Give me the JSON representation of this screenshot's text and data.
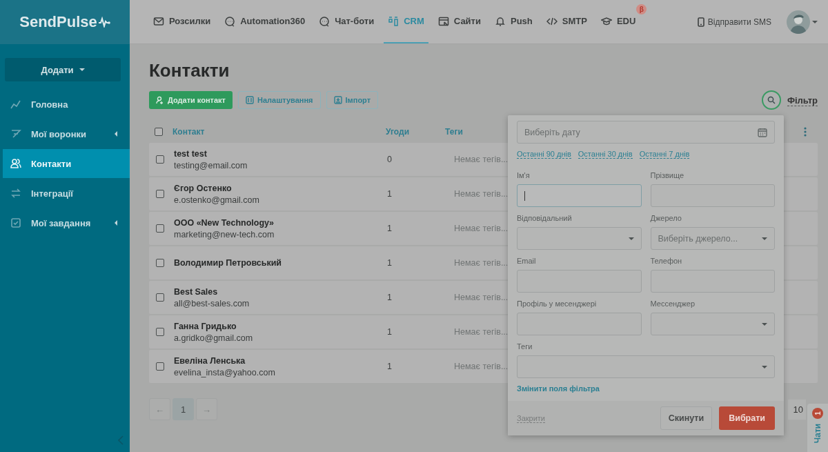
{
  "logo": "SendPulse",
  "nav": [
    {
      "label": "Розсилки",
      "selected": false
    },
    {
      "label": "Automation360",
      "selected": false
    },
    {
      "label": "Чат-боти",
      "selected": false
    },
    {
      "label": "CRM",
      "selected": true
    },
    {
      "label": "Сайти",
      "selected": false
    },
    {
      "label": "Push",
      "selected": false
    },
    {
      "label": "SMTP",
      "selected": false
    },
    {
      "label": "EDU",
      "selected": false,
      "badge": "β"
    }
  ],
  "sms_link": "Відправити SMS",
  "sidebar": {
    "add_button": "Додати",
    "items": [
      {
        "label": "Головна",
        "selected": false,
        "expandable": false
      },
      {
        "label": "Мої воронки",
        "selected": false,
        "expandable": true
      },
      {
        "label": "Контакти",
        "selected": true,
        "expandable": false
      },
      {
        "label": "Інтеграції",
        "selected": false,
        "expandable": false
      },
      {
        "label": "Мої завдання",
        "selected": false,
        "expandable": true
      }
    ]
  },
  "page_title": "Контакти",
  "toolbar": [
    {
      "label": "Додати контакт",
      "kind": "primary"
    },
    {
      "label": "Налаштування",
      "kind": "outline"
    },
    {
      "label": "Імпорт",
      "kind": "outline"
    }
  ],
  "filter_label": "Фільтр",
  "table": {
    "columns": [
      "Контакт",
      "Угоди",
      "Теги"
    ],
    "select_all_checked": false,
    "rows": [
      {
        "name": "test test",
        "email": "testing@email.com",
        "deals": "0",
        "tags": "Немає тегів...",
        "checked": false
      },
      {
        "name": "Єгор Остенко",
        "email": "e.ostenko@gmail.com",
        "deals": "1",
        "tags": "Немає тегів...",
        "checked": false
      },
      {
        "name": "ООО «New Technology»",
        "email": "marketing@new-tech.com",
        "deals": "1",
        "tags": "Немає тегів...",
        "checked": false
      },
      {
        "name": "Володимир Петровський",
        "deals": "1",
        "tags": "Немає тегів...",
        "checked": false
      },
      {
        "name": "Best Sales",
        "email": "all@best-sales.com",
        "deals": "1",
        "tags": "Немає тегів...",
        "checked": false
      },
      {
        "name": "Ганна Гридько",
        "email": "a.gridko@gmail.com",
        "deals": "1",
        "tags": "Немає тегів...",
        "checked": false
      },
      {
        "name": "Евеліна Ленська",
        "email": "evelina_insta@yahoo.com",
        "deals": "1",
        "tags": "Немає тегів...",
        "checked": false
      }
    ]
  },
  "pagination": {
    "prev": "←",
    "pages": [
      {
        "label": "1",
        "selected": true
      }
    ],
    "next": "→",
    "per_page": "10"
  },
  "filter_popup": {
    "date_placeholder": "Виберіть дату",
    "ranges": [
      "Останні 90 днів",
      "Останні 30 днів",
      "Останні 7 днів"
    ],
    "fields": [
      {
        "label": "Ім'я",
        "kind": "text",
        "focused": true,
        "wide": false
      },
      {
        "label": "Прізвище",
        "kind": "text",
        "focused": false,
        "wide": false
      },
      {
        "label": "Відповідальний",
        "kind": "select",
        "focused": false,
        "wide": false
      },
      {
        "label": "Джерело",
        "kind": "select",
        "placeholder": "Виберіть джерело...",
        "focused": false,
        "wide": false
      },
      {
        "label": "Email",
        "kind": "text",
        "focused": false,
        "wide": false
      },
      {
        "label": "Телефон",
        "kind": "text",
        "focused": false,
        "wide": false
      },
      {
        "label": "Профіль у месенджері",
        "kind": "text",
        "focused": false,
        "wide": false
      },
      {
        "label": "Мессенджер",
        "kind": "select",
        "focused": false,
        "wide": false
      },
      {
        "label": "Теги",
        "kind": "select",
        "focused": false,
        "wide": true
      }
    ],
    "edit_fields_link": "Змінити поля фільтра",
    "close_link": "Закрити",
    "reset_button": "Скинути",
    "apply_button": "Вибрати"
  },
  "chat_tab": {
    "label": "Чати",
    "badge": "1"
  }
}
